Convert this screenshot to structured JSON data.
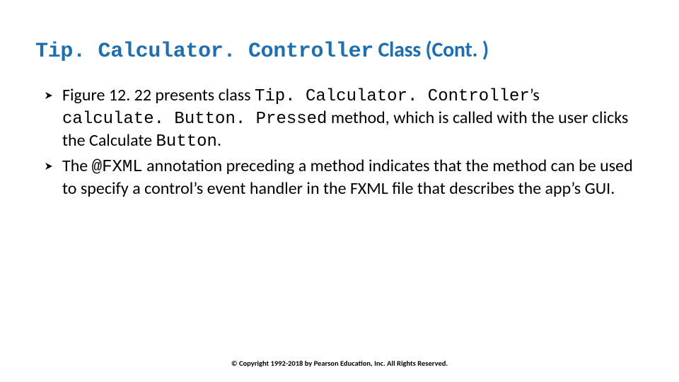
{
  "title": {
    "mono": "Tip. Calculator. Controller",
    "rest": " Class (Cont. )"
  },
  "bullets": {
    "b1": {
      "t1": "Figure 12. 22 presents class ",
      "c1": "Tip. Calculator. Controller",
      "t2": "’s ",
      "c2": "calculate. Button. Pressed",
      "t3": " method, which is called with the user clicks the Calculate ",
      "c3": "Button",
      "t4": "."
    },
    "b2": {
      "t1": "The ",
      "c1": "@FXML",
      "t2": " annotation preceding a method indicates that the method can be used to specify a control’s event handler in the FXML file that describes the app’s GUI."
    }
  },
  "footer": "© Copyright 1992-2018 by Pearson Education, Inc. All Rights Reserved."
}
